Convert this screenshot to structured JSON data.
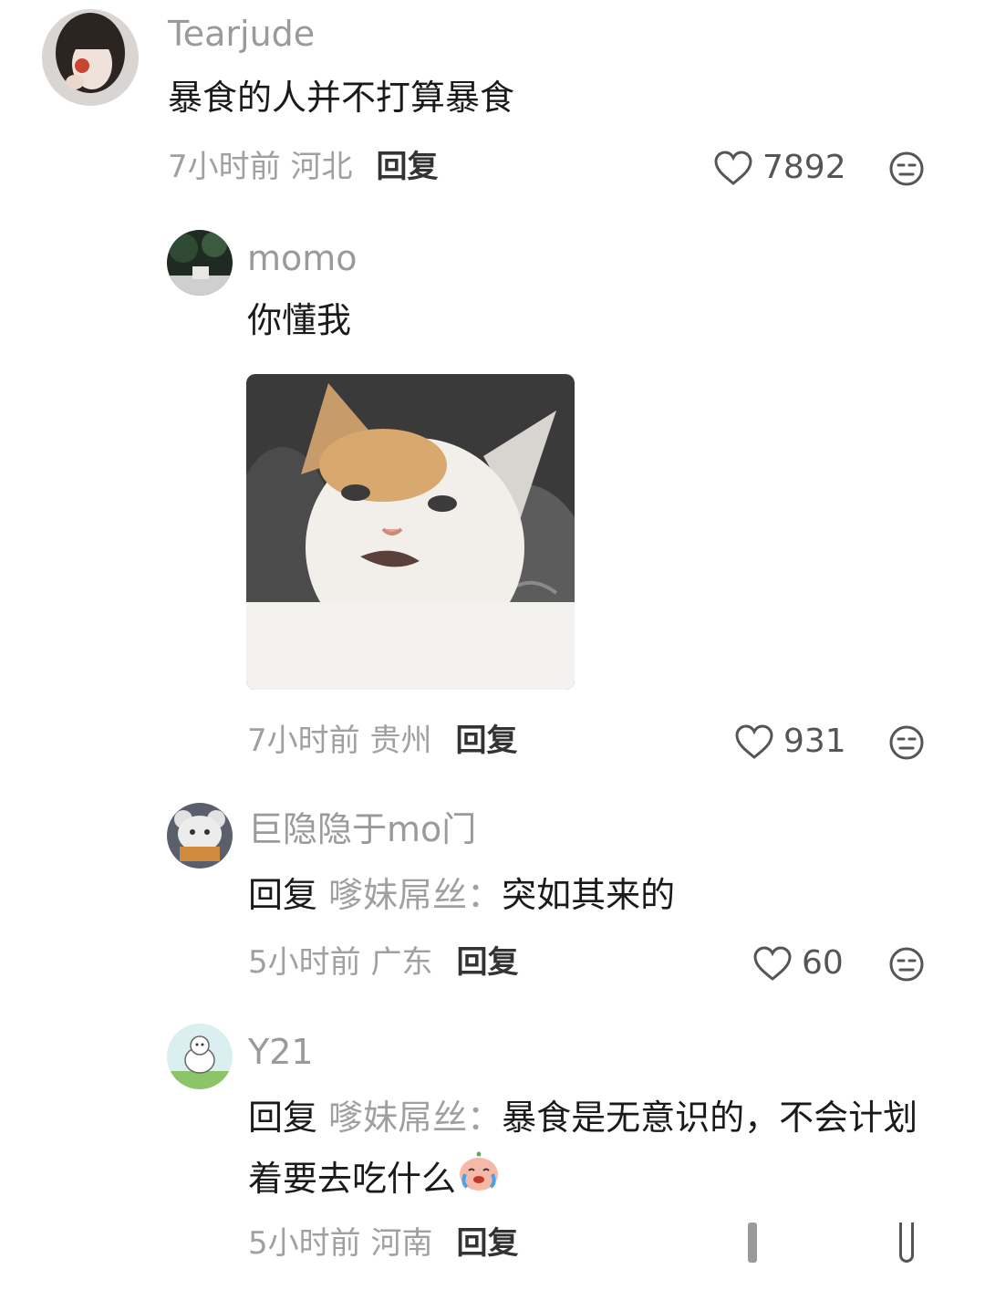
{
  "comments": [
    {
      "username": "Tearjude",
      "text": "暴食的人并不打算暴食",
      "time_location": "7小时前 河北",
      "reply_label": "回复",
      "likes": "7892"
    },
    {
      "username": "momo",
      "text": "你懂我",
      "time_location": "7小时前 贵州",
      "reply_label": "回复",
      "likes": "931",
      "has_image": true
    },
    {
      "username": "巨隐隐于mo门",
      "reply_prefix": "回复",
      "reply_target": "嗲妹屌丝：",
      "text": "突如其来的",
      "time_location": "5小时前 广东",
      "reply_label": "回复",
      "likes": "60"
    },
    {
      "username": "Y21",
      "reply_prefix": "回复",
      "reply_target": "嗲妹屌丝：",
      "text": "暴食是无意识的，不会计划着要去吃什么",
      "time_location": "5小时前 河南",
      "reply_label": "回复"
    }
  ],
  "icons": {
    "like": "heart-outline-icon",
    "dislike": "meh-face-icon",
    "crying_emoji": "crying-emoji-icon"
  },
  "colors": {
    "username": "#9a9a9a",
    "meta": "#a0a0a0",
    "text": "#1a1a1a"
  }
}
